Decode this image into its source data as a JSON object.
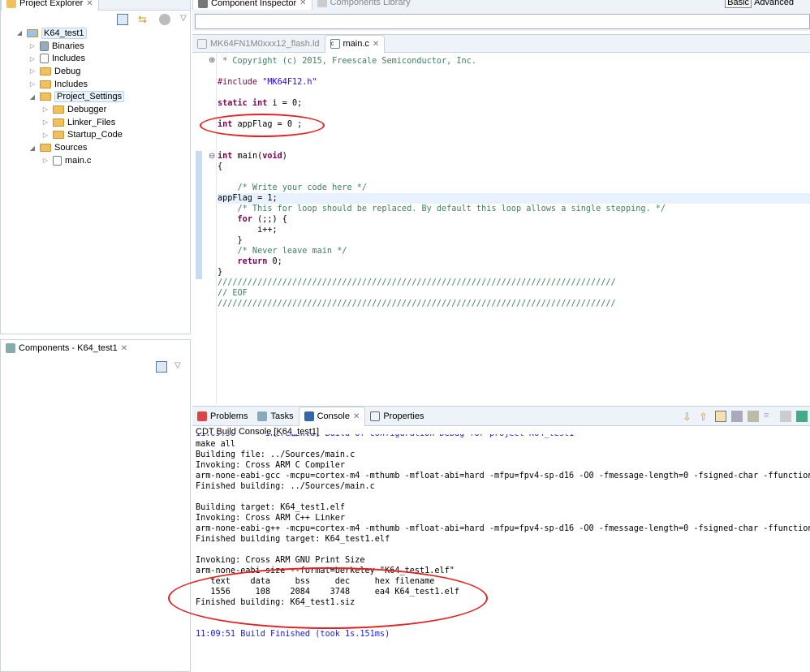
{
  "project_explorer": {
    "title": "Project Explorer",
    "tree": [
      {
        "label": "K64_test1",
        "level": 0,
        "expanded": true,
        "icon": "project-icon",
        "selected": true
      },
      {
        "label": "Binaries",
        "level": 1,
        "icon": "binaries-icon"
      },
      {
        "label": "Includes",
        "level": 1,
        "icon": "includes-icon"
      },
      {
        "label": "Debug",
        "level": 1,
        "icon": "folder-icon"
      },
      {
        "label": "Includes",
        "level": 1,
        "icon": "folder-icon"
      },
      {
        "label": "Project_Settings",
        "level": 1,
        "expanded": true,
        "icon": "folder-icon",
        "selected": true
      },
      {
        "label": "Debugger",
        "level": 2,
        "icon": "folder-icon"
      },
      {
        "label": "Linker_Files",
        "level": 2,
        "icon": "folder-icon"
      },
      {
        "label": "Startup_Code",
        "level": 2,
        "icon": "folder-icon"
      },
      {
        "label": "Sources",
        "level": 1,
        "expanded": true,
        "icon": "folder-icon"
      },
      {
        "label": "main.c",
        "level": 2,
        "icon": "c-file-icon"
      }
    ]
  },
  "components": {
    "title": "Components - K64_test1"
  },
  "inspector": {
    "tabs": [
      "Component Inspector",
      "Components Library"
    ],
    "modes": [
      "Basic",
      "Advanced"
    ]
  },
  "editor": {
    "tabs": [
      "MK64FN1M0xxx12_flash.ld",
      "main.c"
    ],
    "active_tab": "main.c",
    "lines": [
      [
        [
          " * Copyright (c) 2015, Freescale Semiconductor, Inc.",
          "cm"
        ]
      ],
      [],
      [
        [
          "#include ",
          "pp"
        ],
        [
          "\"MK64F12.h\"",
          "str"
        ]
      ],
      [],
      [
        [
          "static int",
          "kw"
        ],
        [
          " i = 0;",
          ""
        ]
      ],
      [],
      [
        [
          "int",
          "kw"
        ],
        [
          " appFlag = 0 ;",
          ""
        ]
      ],
      [],
      [],
      [
        [
          "int",
          "kw"
        ],
        [
          " main(",
          ""
        ],
        [
          "void",
          "kw"
        ],
        [
          ")",
          ""
        ]
      ],
      [
        [
          "{",
          ""
        ]
      ],
      [],
      [
        [
          "    /* Write your code here */",
          "cm"
        ]
      ],
      [
        [
          "appFlag = 1;",
          "hlline"
        ]
      ],
      [
        [
          "    /* This for loop should be replaced. By default this loop allows a single stepping. */",
          "cm"
        ]
      ],
      [
        [
          "    ",
          ""
        ],
        [
          "for",
          "kw"
        ],
        [
          " (;;) {",
          ""
        ]
      ],
      [
        [
          "        i++;",
          ""
        ]
      ],
      [
        [
          "    }",
          ""
        ]
      ],
      [
        [
          "    /* Never leave main */",
          "cm"
        ]
      ],
      [
        [
          "    ",
          ""
        ],
        [
          "return",
          "kw"
        ],
        [
          " 0;",
          ""
        ]
      ],
      [
        [
          "}",
          ""
        ]
      ],
      [
        [
          "////////////////////////////////////////////////////////////////////////////////",
          "cm"
        ]
      ],
      [
        [
          "// EOF",
          "cm"
        ]
      ],
      [
        [
          "////////////////////////////////////////////////////////////////////////////////",
          "cm"
        ]
      ]
    ]
  },
  "bottom": {
    "tabs": [
      "Problems",
      "Tasks",
      "Console",
      "Properties"
    ],
    "active_tab": "Console",
    "console_title": "CDT Build Console [K64_test1]",
    "lines": [
      [
        "11:09:50 **** Incremental Build of configuration Debug for project K64_test1 ****",
        "blue"
      ],
      [
        "make all",
        ""
      ],
      [
        "Building file: ../Sources/main.c",
        ""
      ],
      [
        "Invoking: Cross ARM C Compiler",
        ""
      ],
      [
        "arm-none-eabi-gcc -mcpu=cortex-m4 -mthumb -mfloat-abi=hard -mfpu=fpv4-sp-d16 -O0 -fmessage-length=0 -fsigned-char -ffunction",
        ""
      ],
      [
        "Finished building: ../Sources/main.c",
        ""
      ],
      [
        "",
        ""
      ],
      [
        "Building target: K64_test1.elf",
        ""
      ],
      [
        "Invoking: Cross ARM C++ Linker",
        ""
      ],
      [
        "arm-none-eabi-g++ -mcpu=cortex-m4 -mthumb -mfloat-abi=hard -mfpu=fpv4-sp-d16 -O0 -fmessage-length=0 -fsigned-char -ffunction",
        ""
      ],
      [
        "Finished building target: K64_test1.elf",
        ""
      ],
      [
        "",
        ""
      ],
      [
        "Invoking: Cross ARM GNU Print Size",
        ""
      ],
      [
        "arm-none-eabi-size --format=berkeley \"K64_test1.elf\"",
        ""
      ],
      [
        "   text    data     bss     dec     hex filename",
        ""
      ],
      [
        "   1556     108    2084    3748     ea4 K64_test1.elf",
        ""
      ],
      [
        "Finished building: K64_test1.siz",
        ""
      ],
      [
        "",
        ""
      ],
      [
        "",
        ""
      ],
      [
        "11:09:51 Build Finished (took 1s.151ms)",
        "blue"
      ]
    ]
  },
  "colors": {
    "annotation": "#e52020",
    "keyword": "#7f0055",
    "comment": "#3f7f5f",
    "string": "#2a00ff",
    "console_info": "#2020e0"
  }
}
